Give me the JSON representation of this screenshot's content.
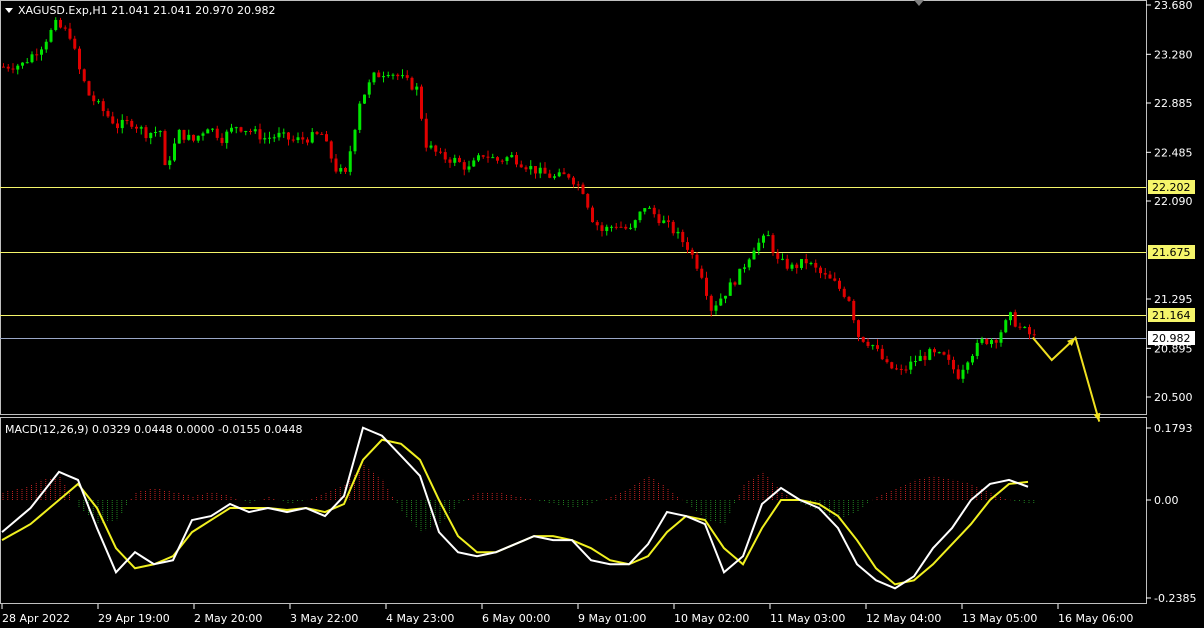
{
  "header": {
    "symbol_line": "XAGUSD.Exp,H1  21.041 21.041 20.970 20.982",
    "dropdown_icon": "triangle-down-icon"
  },
  "macd_header": "MACD(12,26,9) 0.0329 0.0448 0.0000 -0.0155 0.0448",
  "price_axis": {
    "ticks": [
      "23.680",
      "23.280",
      "22.885",
      "22.485",
      "22.090",
      "21.295",
      "20.895",
      "20.500"
    ],
    "tick_values": [
      23.68,
      23.28,
      22.885,
      22.485,
      22.09,
      21.295,
      20.895,
      20.5
    ]
  },
  "macd_axis": {
    "ticks": [
      "0.1793",
      "0.00",
      "-0.2385"
    ],
    "tick_values": [
      0.1793,
      0.0,
      -0.2385
    ]
  },
  "levels": [
    {
      "label": "22.202",
      "value": 22.202,
      "color": "#f5f56a",
      "kind": "resistance"
    },
    {
      "label": "21.675",
      "value": 21.675,
      "color": "#f5f56a",
      "kind": "resistance"
    },
    {
      "label": "21.164",
      "value": 21.164,
      "color": "#f5f56a",
      "kind": "support"
    },
    {
      "label": "20.982",
      "value": 20.982,
      "color": "#9aa7c7",
      "kind": "current-price"
    }
  ],
  "time_axis": {
    "labels": [
      "28 Apr 2022",
      "29 Apr 19:00",
      "2 May 20:00",
      "3 May 22:00",
      "4 May 23:00",
      "6 May 00:00",
      "9 May 01:00",
      "10 May 02:00",
      "11 May 03:00",
      "12 May 04:00",
      "13 May 05:00",
      "16 May 06:00"
    ]
  },
  "colors": {
    "bull": "#00e600",
    "bear": "#e00000",
    "macd_line": "#ffffff",
    "signal_line": "#f0f020",
    "hist_pos": "#c02020",
    "hist_neg": "#208020",
    "forecast_arrow": "#f0e020",
    "axis": "#ffffff"
  },
  "chart_data": {
    "type": "candlestick",
    "symbol": "XAGUSD.Exp",
    "timeframe": "H1",
    "ohlc_last": {
      "open": 21.041,
      "high": 21.041,
      "low": 20.97,
      "close": 20.982
    },
    "ylim": [
      20.4,
      23.68
    ],
    "close_path": [
      [
        0,
        23.18
      ],
      [
        4,
        23.2
      ],
      [
        8,
        23.35
      ],
      [
        11,
        23.52
      ],
      [
        14,
        23.44
      ],
      [
        16,
        23.15
      ],
      [
        18,
        22.95
      ],
      [
        21,
        22.82
      ],
      [
        24,
        22.7
      ],
      [
        27,
        22.73
      ],
      [
        30,
        22.64
      ],
      [
        33,
        22.66
      ],
      [
        34,
        22.35
      ],
      [
        37,
        22.64
      ],
      [
        40,
        22.58
      ],
      [
        43,
        22.7
      ],
      [
        46,
        22.6
      ],
      [
        49,
        22.7
      ],
      [
        52,
        22.66
      ],
      [
        55,
        22.6
      ],
      [
        58,
        22.62
      ],
      [
        61,
        22.58
      ],
      [
        64,
        22.6
      ],
      [
        67,
        22.63
      ],
      [
        70,
        22.35
      ],
      [
        72,
        22.3
      ],
      [
        75,
        22.9
      ],
      [
        78,
        23.1
      ],
      [
        81,
        23.15
      ],
      [
        84,
        23.08
      ],
      [
        87,
        23.0
      ],
      [
        89,
        22.55
      ],
      [
        92,
        22.45
      ],
      [
        95,
        22.42
      ],
      [
        98,
        22.35
      ],
      [
        101,
        22.47
      ],
      [
        104,
        22.42
      ],
      [
        107,
        22.45
      ],
      [
        110,
        22.38
      ],
      [
        113,
        22.32
      ],
      [
        116,
        22.28
      ],
      [
        119,
        22.3
      ],
      [
        122,
        22.18
      ],
      [
        124,
        21.95
      ],
      [
        126,
        21.85
      ],
      [
        129,
        21.9
      ],
      [
        132,
        21.85
      ],
      [
        135,
        22.05
      ],
      [
        138,
        21.95
      ],
      [
        141,
        21.85
      ],
      [
        144,
        21.72
      ],
      [
        147,
        21.5
      ],
      [
        149,
        21.22
      ],
      [
        152,
        21.35
      ],
      [
        155,
        21.5
      ],
      [
        158,
        21.72
      ],
      [
        161,
        21.8
      ],
      [
        163,
        21.6
      ],
      [
        166,
        21.55
      ],
      [
        169,
        21.6
      ],
      [
        172,
        21.5
      ],
      [
        175,
        21.42
      ],
      [
        178,
        21.3
      ],
      [
        180,
        21.0
      ],
      [
        183,
        20.92
      ],
      [
        186,
        20.75
      ],
      [
        189,
        20.7
      ],
      [
        192,
        20.8
      ],
      [
        195,
        20.85
      ],
      [
        198,
        20.82
      ],
      [
        201,
        20.68
      ],
      [
        203,
        20.82
      ],
      [
        206,
        20.95
      ],
      [
        209,
        20.98
      ],
      [
        212,
        21.15
      ],
      [
        214,
        21.06
      ],
      [
        217,
        20.982
      ]
    ],
    "forecast_path": [
      [
        217,
        20.982
      ],
      [
        221,
        20.8
      ],
      [
        226,
        20.98
      ],
      [
        231,
        20.3
      ]
    ],
    "macd": {
      "name": "MACD(12,26,9)",
      "values": {
        "main": 0.0329,
        "signal": 0.0448,
        "v3": 0.0,
        "v4": -0.0155,
        "v5": 0.0448
      },
      "ylim": [
        -0.2385,
        0.1793
      ],
      "main_line": [
        [
          0,
          -0.08
        ],
        [
          6,
          -0.02
        ],
        [
          12,
          0.07
        ],
        [
          16,
          0.05
        ],
        [
          20,
          -0.07
        ],
        [
          24,
          -0.18
        ],
        [
          28,
          -0.13
        ],
        [
          32,
          -0.16
        ],
        [
          36,
          -0.15
        ],
        [
          40,
          -0.05
        ],
        [
          44,
          -0.04
        ],
        [
          48,
          -0.01
        ],
        [
          52,
          -0.03
        ],
        [
          56,
          -0.02
        ],
        [
          60,
          -0.03
        ],
        [
          64,
          -0.02
        ],
        [
          68,
          -0.04
        ],
        [
          72,
          0.01
        ],
        [
          76,
          0.18
        ],
        [
          80,
          0.16
        ],
        [
          84,
          0.11
        ],
        [
          88,
          0.06
        ],
        [
          92,
          -0.08
        ],
        [
          96,
          -0.13
        ],
        [
          100,
          -0.14
        ],
        [
          104,
          -0.13
        ],
        [
          108,
          -0.11
        ],
        [
          112,
          -0.09
        ],
        [
          116,
          -0.1
        ],
        [
          120,
          -0.1
        ],
        [
          124,
          -0.15
        ],
        [
          128,
          -0.16
        ],
        [
          132,
          -0.16
        ],
        [
          136,
          -0.11
        ],
        [
          140,
          -0.03
        ],
        [
          144,
          -0.04
        ],
        [
          148,
          -0.06
        ],
        [
          152,
          -0.18
        ],
        [
          156,
          -0.14
        ],
        [
          160,
          -0.01
        ],
        [
          164,
          0.03
        ],
        [
          168,
          0.0
        ],
        [
          172,
          -0.02
        ],
        [
          176,
          -0.07
        ],
        [
          180,
          -0.16
        ],
        [
          184,
          -0.2
        ],
        [
          188,
          -0.22
        ],
        [
          192,
          -0.19
        ],
        [
          196,
          -0.12
        ],
        [
          200,
          -0.07
        ],
        [
          204,
          0.0
        ],
        [
          208,
          0.04
        ],
        [
          212,
          0.05
        ],
        [
          216,
          0.033
        ]
      ],
      "signal_line": [
        [
          0,
          -0.1
        ],
        [
          6,
          -0.06
        ],
        [
          12,
          0.0
        ],
        [
          16,
          0.04
        ],
        [
          20,
          -0.02
        ],
        [
          24,
          -0.12
        ],
        [
          28,
          -0.17
        ],
        [
          32,
          -0.16
        ],
        [
          36,
          -0.14
        ],
        [
          40,
          -0.08
        ],
        [
          44,
          -0.05
        ],
        [
          48,
          -0.02
        ],
        [
          52,
          -0.02
        ],
        [
          56,
          -0.02
        ],
        [
          60,
          -0.025
        ],
        [
          64,
          -0.02
        ],
        [
          68,
          -0.03
        ],
        [
          72,
          -0.01
        ],
        [
          76,
          0.1
        ],
        [
          80,
          0.15
        ],
        [
          84,
          0.14
        ],
        [
          88,
          0.1
        ],
        [
          92,
          0.0
        ],
        [
          96,
          -0.09
        ],
        [
          100,
          -0.13
        ],
        [
          104,
          -0.13
        ],
        [
          108,
          -0.11
        ],
        [
          112,
          -0.09
        ],
        [
          116,
          -0.09
        ],
        [
          120,
          -0.1
        ],
        [
          124,
          -0.12
        ],
        [
          128,
          -0.15
        ],
        [
          132,
          -0.16
        ],
        [
          136,
          -0.14
        ],
        [
          140,
          -0.08
        ],
        [
          144,
          -0.04
        ],
        [
          148,
          -0.05
        ],
        [
          152,
          -0.12
        ],
        [
          156,
          -0.16
        ],
        [
          160,
          -0.07
        ],
        [
          164,
          0.0
        ],
        [
          168,
          0.0
        ],
        [
          172,
          -0.01
        ],
        [
          176,
          -0.04
        ],
        [
          180,
          -0.1
        ],
        [
          184,
          -0.17
        ],
        [
          188,
          -0.21
        ],
        [
          192,
          -0.2
        ],
        [
          196,
          -0.16
        ],
        [
          200,
          -0.11
        ],
        [
          204,
          -0.06
        ],
        [
          208,
          0.0
        ],
        [
          212,
          0.04
        ],
        [
          216,
          0.045
        ]
      ],
      "histogram": [
        [
          0,
          0.02
        ],
        [
          4,
          0.03
        ],
        [
          8,
          0.05
        ],
        [
          12,
          0.06
        ],
        [
          14,
          0.02
        ],
        [
          16,
          -0.02
        ],
        [
          20,
          -0.06
        ],
        [
          24,
          -0.05
        ],
        [
          28,
          0.02
        ],
        [
          32,
          0.03
        ],
        [
          36,
          0.02
        ],
        [
          40,
          0.01
        ],
        [
          44,
          0.02
        ],
        [
          48,
          0.01
        ],
        [
          52,
          -0.01
        ],
        [
          56,
          0.01
        ],
        [
          60,
          -0.01
        ],
        [
          64,
          0.0
        ],
        [
          68,
          0.02
        ],
        [
          72,
          0.04
        ],
        [
          76,
          0.09
        ],
        [
          80,
          0.05
        ],
        [
          84,
          -0.03
        ],
        [
          88,
          -0.08
        ],
        [
          92,
          -0.06
        ],
        [
          96,
          -0.01
        ],
        [
          100,
          0.02
        ],
        [
          104,
          0.02
        ],
        [
          108,
          0.01
        ],
        [
          112,
          0.0
        ],
        [
          116,
          -0.01
        ],
        [
          120,
          -0.02
        ],
        [
          124,
          -0.01
        ],
        [
          128,
          0.01
        ],
        [
          132,
          0.03
        ],
        [
          136,
          0.06
        ],
        [
          140,
          0.03
        ],
        [
          144,
          -0.01
        ],
        [
          148,
          -0.05
        ],
        [
          152,
          -0.06
        ],
        [
          156,
          0.04
        ],
        [
          160,
          0.07
        ],
        [
          164,
          0.02
        ],
        [
          168,
          -0.01
        ],
        [
          172,
          -0.03
        ],
        [
          176,
          -0.05
        ],
        [
          180,
          -0.03
        ],
        [
          184,
          0.01
        ],
        [
          188,
          0.03
        ],
        [
          192,
          0.05
        ],
        [
          196,
          0.06
        ],
        [
          200,
          0.05
        ],
        [
          204,
          0.04
        ],
        [
          208,
          0.02
        ],
        [
          212,
          0.0
        ],
        [
          216,
          -0.01
        ]
      ]
    }
  }
}
